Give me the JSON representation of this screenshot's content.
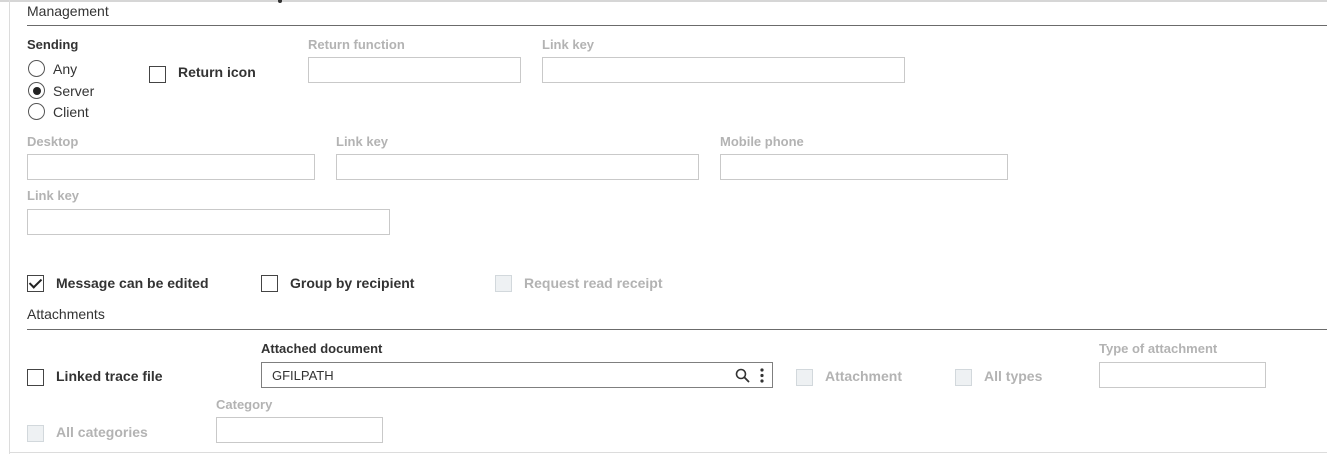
{
  "management": {
    "title": "Management",
    "sending": {
      "label": "Sending",
      "options": [
        "Any",
        "Server",
        "Client"
      ],
      "selected": "Server"
    },
    "return_icon": {
      "label": "Return icon",
      "checked": false
    },
    "return_function": {
      "label": "Return function",
      "value": ""
    },
    "link_key_1": {
      "label": "Link key",
      "value": ""
    },
    "desktop": {
      "label": "Desktop",
      "value": ""
    },
    "link_key_2": {
      "label": "Link key",
      "value": ""
    },
    "mobile_phone": {
      "label": "Mobile phone",
      "value": ""
    },
    "link_key_3": {
      "label": "Link key",
      "value": ""
    },
    "message_editable": {
      "label": "Message can be edited",
      "checked": true
    },
    "group_by_recipient": {
      "label": "Group by recipient",
      "checked": false
    },
    "request_read_receipt": {
      "label": "Request read receipt",
      "checked": false,
      "disabled": true
    }
  },
  "attachments": {
    "title": "Attachments",
    "linked_trace_file": {
      "label": "Linked trace file",
      "checked": false
    },
    "attached_document": {
      "label": "Attached document",
      "value": "GFILPATH"
    },
    "attachment": {
      "label": "Attachment",
      "checked": false,
      "disabled": true
    },
    "all_types": {
      "label": "All types",
      "checked": false,
      "disabled": true
    },
    "type_of_attachment": {
      "label": "Type of attachment",
      "value": ""
    },
    "category": {
      "label": "Category",
      "value": ""
    },
    "all_categories": {
      "label": "All categories",
      "checked": false,
      "disabled": true
    }
  },
  "icons": {
    "search": "search-icon",
    "more": "vertical-ellipsis-icon"
  }
}
